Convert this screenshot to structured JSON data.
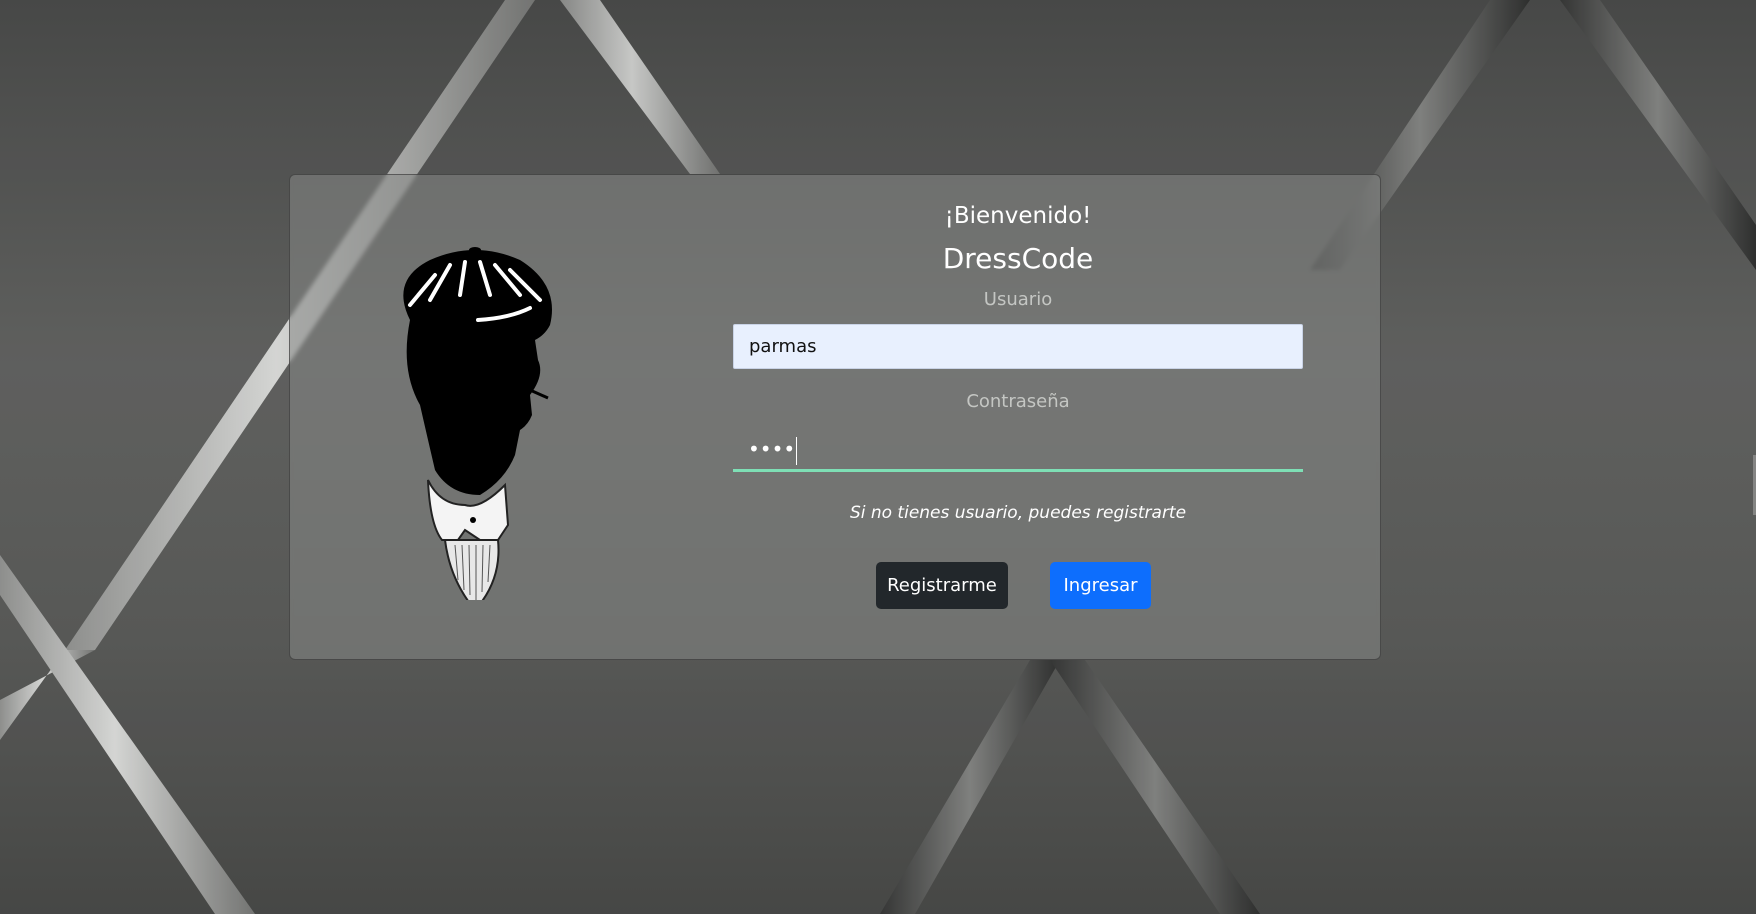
{
  "login": {
    "welcome": "¡Bienvenido!",
    "brand": "DressCode",
    "username_label": "Usuario",
    "username_value": "parmas",
    "password_label": "Contraseña",
    "password_masked": "••••",
    "hint": "Si no tienes usuario, puedes registrarte",
    "register_button": "Registrarme",
    "login_button": "Ingresar"
  },
  "colors": {
    "login_button": "#0d6efd",
    "register_button": "#22272b",
    "password_focus_underline": "#7ee0b6",
    "username_field_bg": "#e8f0fe"
  },
  "icons": {
    "logo": "gentleman-silhouette-logo"
  }
}
